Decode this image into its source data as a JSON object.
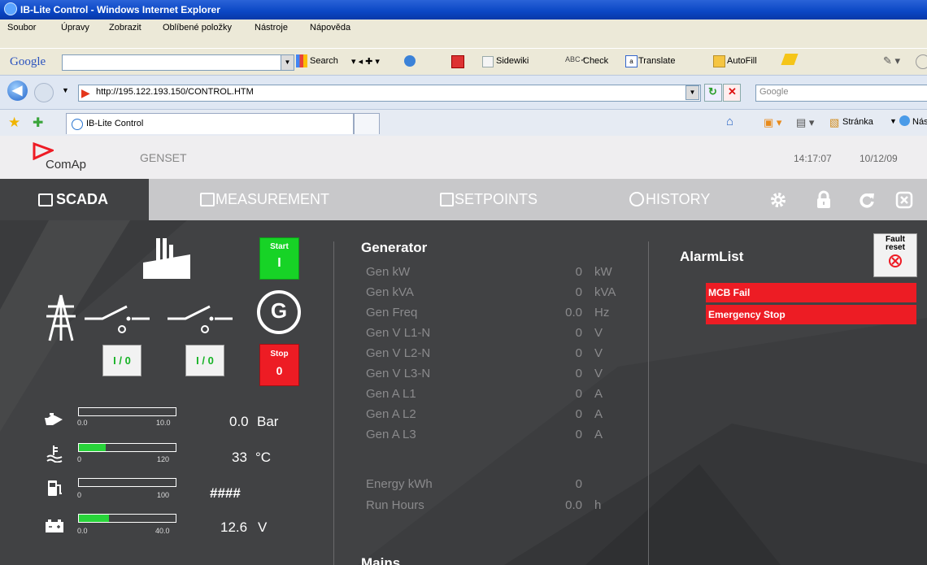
{
  "window": {
    "title": "IB-Lite Control - Windows Internet Explorer"
  },
  "menu": [
    "Soubor",
    "Úpravy",
    "Zobrazit",
    "Oblíbené položky",
    "Nástroje",
    "Nápověda"
  ],
  "googlebar": {
    "brand": "Google",
    "search": "Search",
    "sidewiki": "Sidewiki",
    "check": "Check",
    "translate": "Translate",
    "autofill": "AutoFill"
  },
  "address": {
    "url": "http://195.122.193.150/CONTROL.HTM",
    "search_placeholder": "Google"
  },
  "tab": {
    "label": "IB-Lite Control"
  },
  "pagebar": {
    "page": "Stránka",
    "tools": "Nás"
  },
  "app": {
    "logo": "ComAp",
    "device": "GENSET",
    "time": "14:17:07",
    "date": "10/12/09"
  },
  "nav": {
    "scada": "SCADA",
    "measurement": "MEASUREMENT",
    "setpoints": "SETPOINTS",
    "history": "HISTORY"
  },
  "controls": {
    "start_label": "Start",
    "start_symbol": "I",
    "stop_label": "Stop",
    "stop_symbol": "0",
    "breaker1": "I / 0",
    "breaker2": "I / 0",
    "generator_symbol": "G"
  },
  "gauges": [
    {
      "min": "0.0",
      "max": "10.0",
      "value": "0.0",
      "unit": "Bar",
      "fill": 0
    },
    {
      "min": "0",
      "max": "120",
      "value": "33",
      "unit": "°C",
      "fill": 0.275
    },
    {
      "min": "0",
      "max": "100",
      "value": "####",
      "unit": "",
      "fill": 0
    },
    {
      "min": "0.0",
      "max": "40.0",
      "value": "12.6",
      "unit": "V",
      "fill": 0.315
    }
  ],
  "generator": {
    "title": "Generator",
    "rows": [
      {
        "label": "Gen kW",
        "value": "0",
        "unit": "kW"
      },
      {
        "label": "Gen kVA",
        "value": "0",
        "unit": "kVA"
      },
      {
        "label": "Gen Freq",
        "value": "0.0",
        "unit": "Hz"
      },
      {
        "label": "Gen V L1-N",
        "value": "0",
        "unit": "V"
      },
      {
        "label": "Gen V L2-N",
        "value": "0",
        "unit": "V"
      },
      {
        "label": "Gen V L3-N",
        "value": "0",
        "unit": "V"
      },
      {
        "label": "Gen A L1",
        "value": "0",
        "unit": "A"
      },
      {
        "label": "Gen A L2",
        "value": "0",
        "unit": "A"
      },
      {
        "label": "Gen A L3",
        "value": "0",
        "unit": "A"
      }
    ],
    "energy_label": "Energy kWh",
    "energy_value": "0",
    "runhours_label": "Run Hours",
    "runhours_value": "0.0",
    "runhours_unit": "h"
  },
  "mains": {
    "title": "Mains"
  },
  "alarms": {
    "title": "AlarmList",
    "fault_reset_1": "Fault",
    "fault_reset_2": "reset",
    "items": [
      "MCB Fail",
      "Emergency Stop"
    ]
  },
  "colors": {
    "accent": "#ee1b24",
    "start": "#17d326",
    "stop": "#ed1c24",
    "panel": "#414244",
    "nav": "#c8c8ca"
  }
}
